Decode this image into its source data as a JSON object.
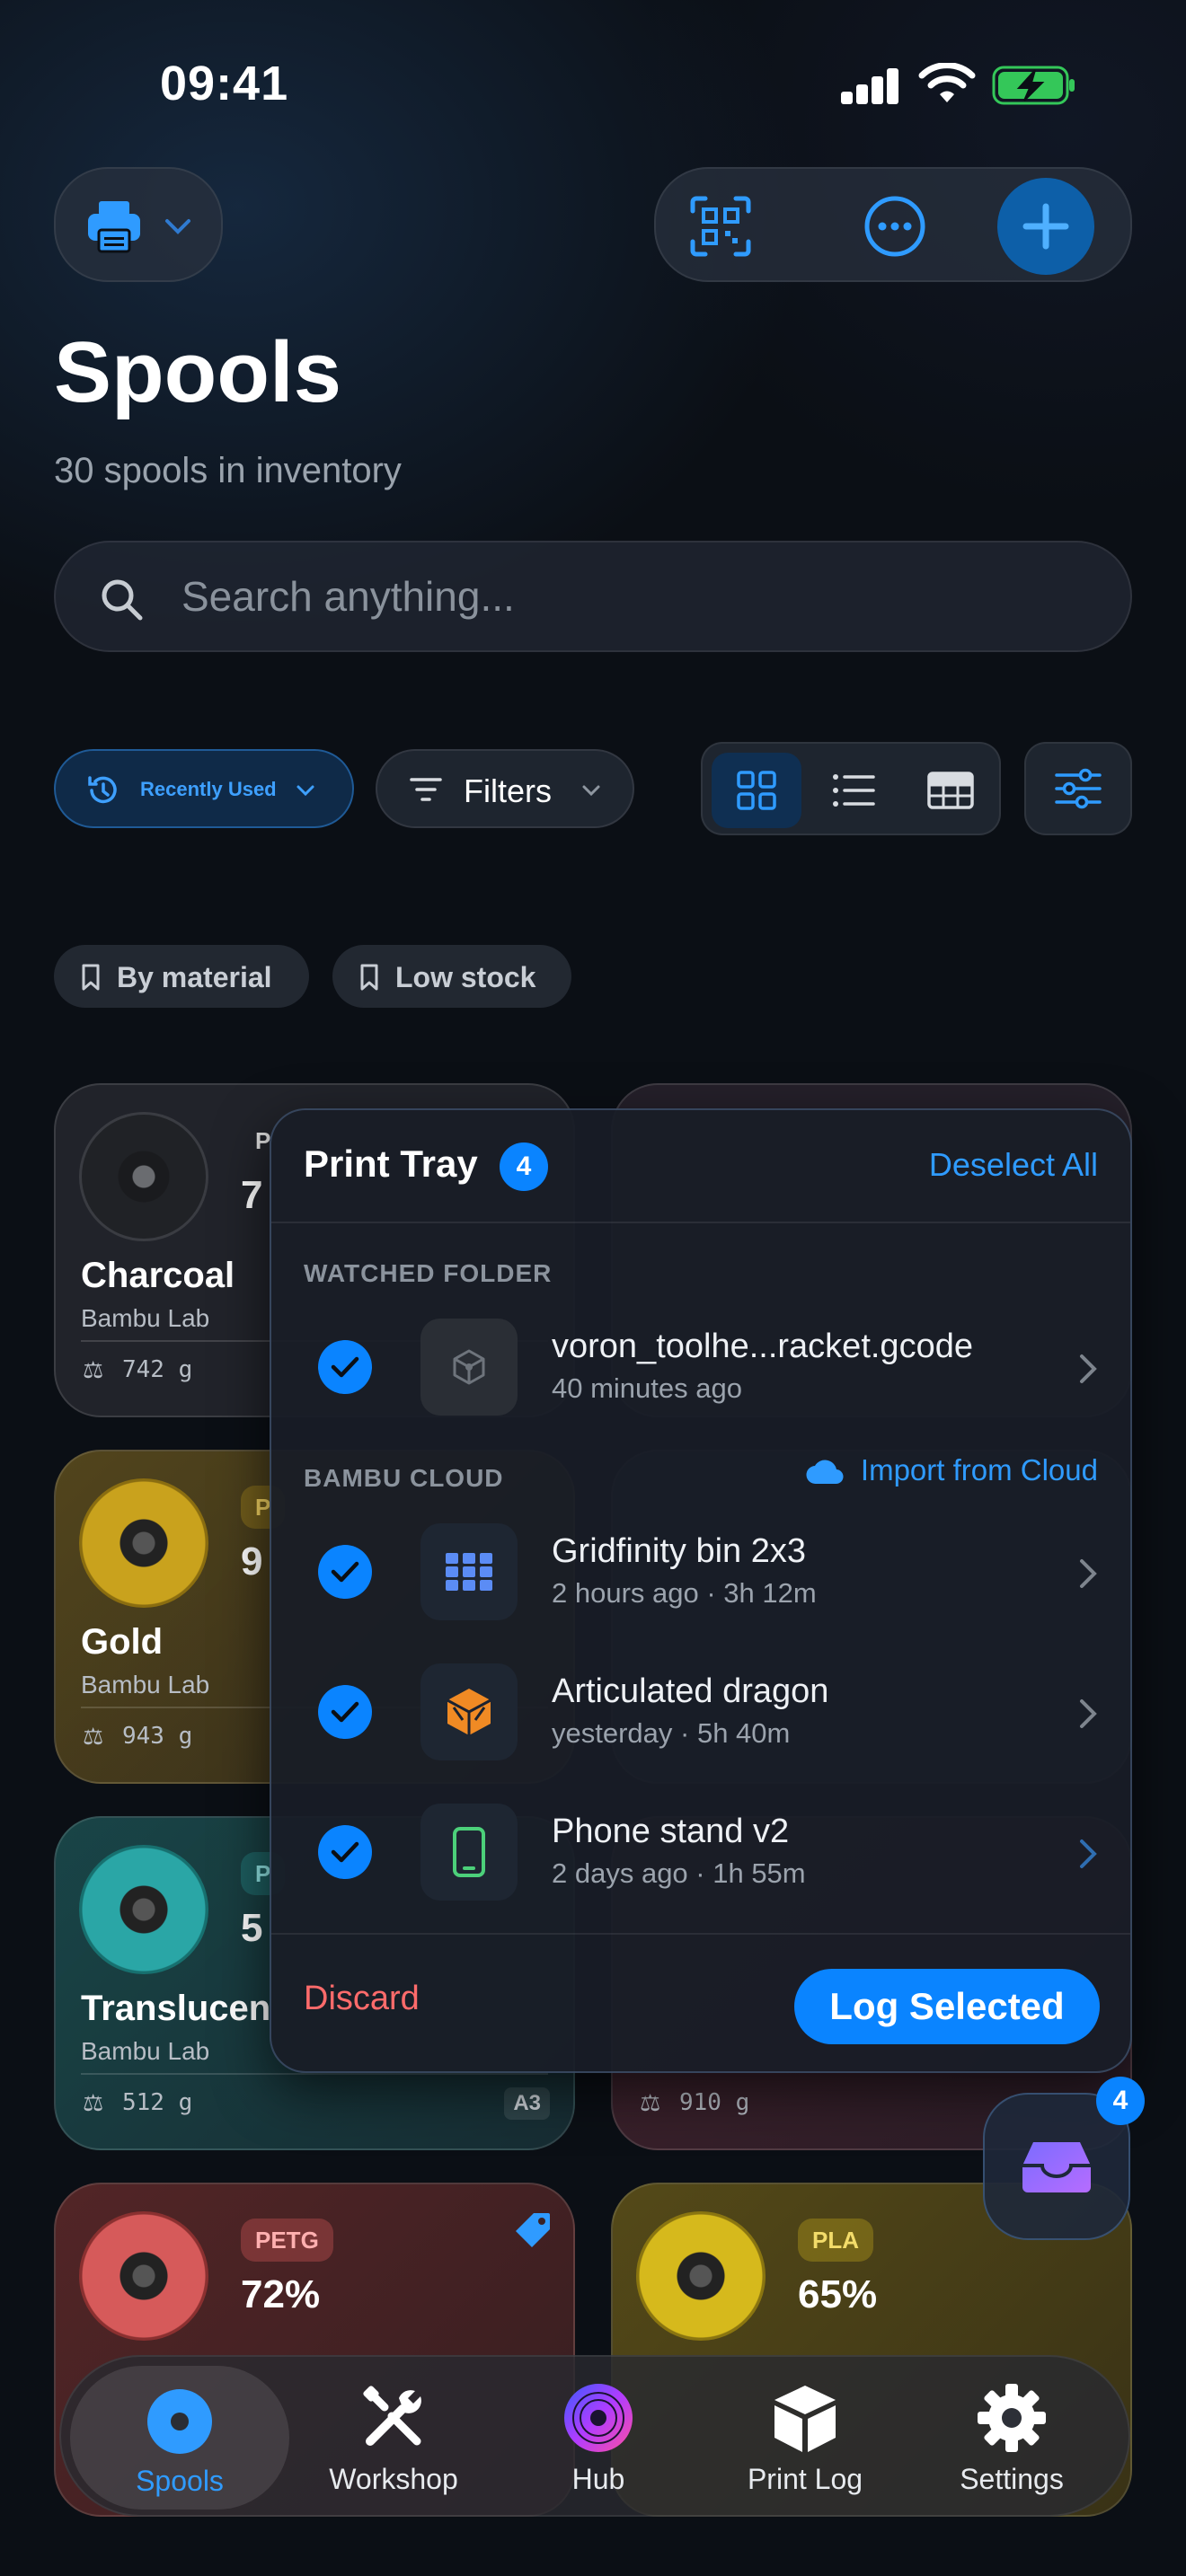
{
  "status": {
    "time": "09:41"
  },
  "header": {
    "title": "Spools",
    "subtitle": "30 spools in inventory"
  },
  "search": {
    "placeholder": "Search anything..."
  },
  "toolbar": {
    "sort_label": "Recently Used",
    "filters_label": "Filters",
    "view_modes": [
      "grid",
      "list",
      "table"
    ],
    "active_view": "grid"
  },
  "saved_filters": [
    "By material",
    "Low stock"
  ],
  "cards": [
    {
      "name": "Charcoal",
      "brand": "Bambu Lab",
      "weight": "742 g",
      "badge": "P",
      "pct": "7",
      "color": "#2a2c30"
    },
    {
      "name": "Gold",
      "brand": "Bambu Lab",
      "weight": "943 g",
      "badge": "P",
      "pct": "9",
      "color": "#c9a21d"
    },
    {
      "name": "Translucen",
      "brand": "Bambu Lab",
      "weight": "512 g",
      "badge": "P",
      "pct": "5",
      "slot": "A3",
      "color": "#2aa6a6"
    },
    {
      "name": "",
      "brand": "",
      "weight": "910 g",
      "color": "#b45a6a"
    },
    {
      "name": "",
      "brand": "",
      "weight": "",
      "badge": "PETG",
      "pct": "72%",
      "color": "#d65a5a"
    },
    {
      "name": "",
      "brand": "",
      "weight": "",
      "badge": "PLA",
      "pct": "65%",
      "color": "#d6b91c"
    }
  ],
  "tray": {
    "title": "Print Tray",
    "count": "4",
    "deselect_label": "Deselect All",
    "watched_label": "WATCHED FOLDER",
    "cloud_label": "BAMBU CLOUD",
    "import_label": "Import from Cloud",
    "discard_label": "Discard",
    "log_label": "Log Selected",
    "items": [
      {
        "title": "voron_toolhe...racket.gcode",
        "subtitle": "40 minutes ago",
        "icon": "cube-icon"
      },
      {
        "title": "Gridfinity bin 2x3",
        "subtitle": "2 hours ago · 3h 12m",
        "icon": "grid-icon"
      },
      {
        "title": "Articulated dragon",
        "subtitle": "yesterday · 5h 40m",
        "icon": "dragon-cube-icon"
      },
      {
        "title": "Phone stand v2",
        "subtitle": "2 days ago · 1h 55m",
        "icon": "phone-icon"
      }
    ]
  },
  "fab": {
    "badge": "4"
  },
  "tabs": [
    {
      "label": "Spools",
      "icon": "spool-icon"
    },
    {
      "label": "Workshop",
      "icon": "tools-icon"
    },
    {
      "label": "Hub",
      "icon": "hub-icon"
    },
    {
      "label": "Print Log",
      "icon": "box-icon"
    },
    {
      "label": "Settings",
      "icon": "gear-icon"
    }
  ],
  "colors": {
    "accent": "#0a84ff",
    "danger": "#ff6b6b"
  }
}
